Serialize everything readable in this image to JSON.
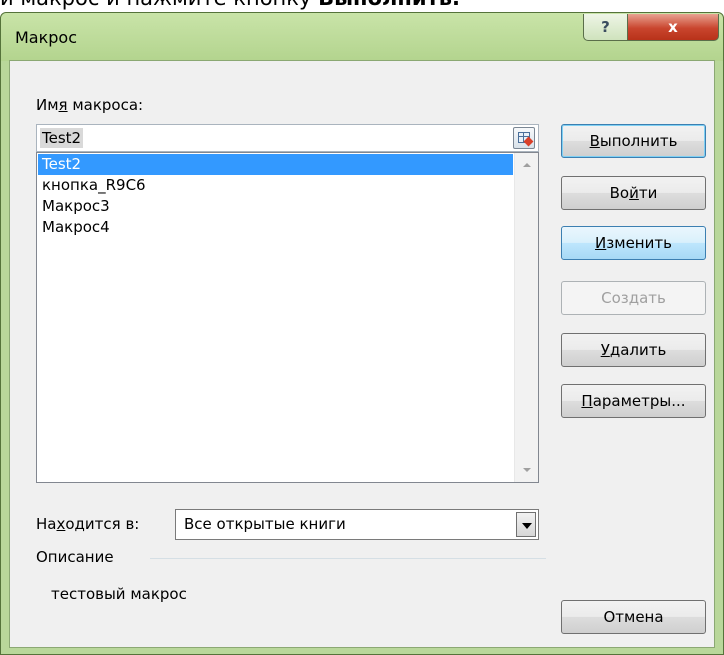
{
  "background_text": {
    "normal": "и макрос и нажмите кнопку ",
    "bold": "Выполнить."
  },
  "window": {
    "title": "Макрос",
    "help_glyph": "?",
    "close_glyph": "x"
  },
  "macro_name": {
    "label_pre": "Им",
    "label_u": "я",
    "label_post": " макроса:",
    "value": "Test2"
  },
  "macros": [
    {
      "name": "Test2",
      "selected": true
    },
    {
      "name": "кнопка_R9C6",
      "selected": false
    },
    {
      "name": "Макрос3",
      "selected": false
    },
    {
      "name": "Макрос4",
      "selected": false
    }
  ],
  "buttons": {
    "run": {
      "u": "В",
      "rest": "ыполнить"
    },
    "step_into_pre": "Во",
    "step_into_u": "й",
    "step_into_post": "ти",
    "edit": {
      "u": "И",
      "rest": "зменить"
    },
    "create": "Создать",
    "delete": {
      "u": "У",
      "rest": "далить"
    },
    "options": {
      "u": "П",
      "rest": "араметры..."
    },
    "cancel": "Отмена"
  },
  "location": {
    "label_pre": "На",
    "label_u": "х",
    "label_post": "одится в:",
    "value": "Все открытые книги"
  },
  "description": {
    "label": "Описание",
    "text": "тестовый макрос"
  }
}
